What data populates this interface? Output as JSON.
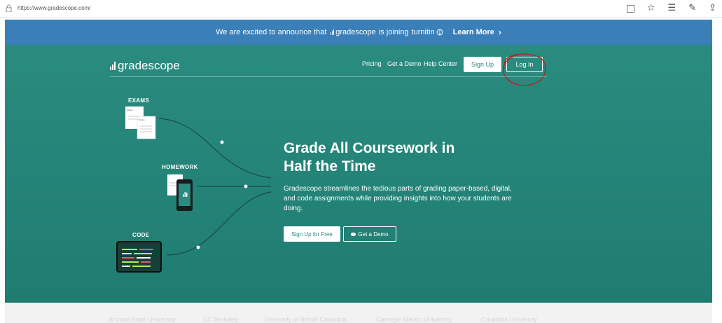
{
  "browser": {
    "url": "https://www.gradescope.com/"
  },
  "announcement": {
    "text": "We are excited to announce that",
    "brand": "gradescope",
    "joining": "is joining",
    "partner": "turnitin",
    "learn_more": "Learn More"
  },
  "header": {
    "brand": "gradescope",
    "nav": [
      "Pricing",
      "Get a Demo",
      "Help Center"
    ],
    "signup": "Sign Up",
    "login": "Log In"
  },
  "hero": {
    "heading_line1": "Grade All Coursework in",
    "heading_line2": "Half the Time",
    "description": "Gradescope streamlines the tedious parts of grading paper-based, digital, and code assignments while providing insights into how your students are doing.",
    "cta_primary": "Sign Up for Free",
    "cta_secondary": "Get a Demo",
    "labels": {
      "exams": "EXAMS",
      "homework": "HOMEWORK",
      "code": "CODE"
    },
    "exam_doc_text": "Exam"
  },
  "universities": [
    "Arizona State University",
    "UC Berkeley",
    "University of British Columbia",
    "Carnegie Mellon University",
    "Columbia University"
  ],
  "colors": {
    "announce_bg": "#3a7fb8",
    "hero_bg": "#2a8b7f",
    "annotation": "#b32020"
  }
}
